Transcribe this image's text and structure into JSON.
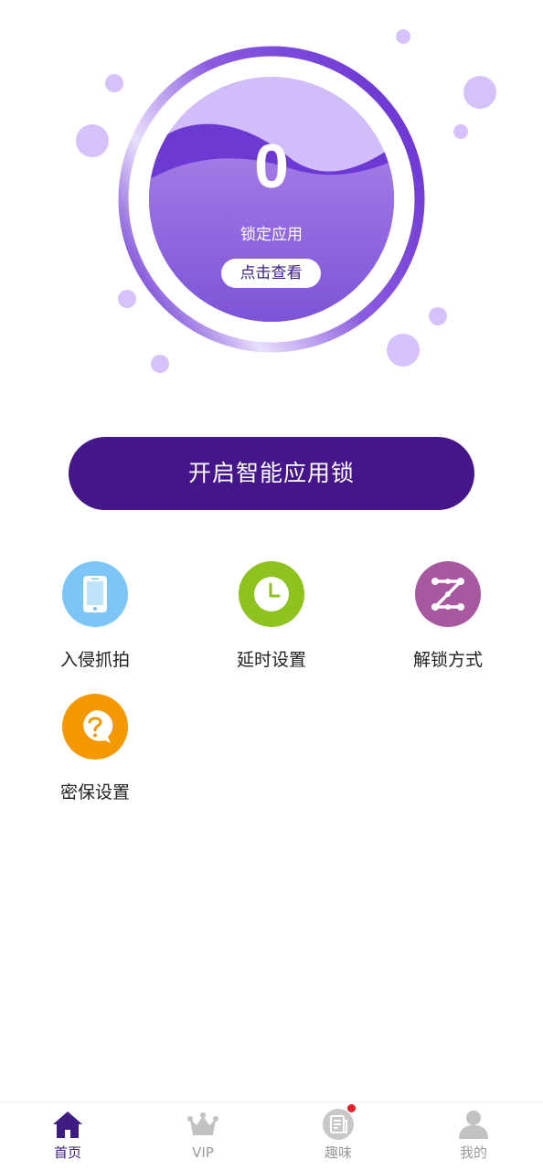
{
  "hero": {
    "locked_count": "0",
    "locked_label": "锁定应用",
    "view_button": "点击查看"
  },
  "main_button": "开启智能应用锁",
  "features": [
    {
      "label": "入侵抓拍",
      "icon": "phone-icon",
      "color": "#7cc6f7"
    },
    {
      "label": "延时设置",
      "icon": "clock-icon",
      "color": "#8dc21f"
    },
    {
      "label": "解锁方式",
      "icon": "pattern-z-icon",
      "color": "#a8589e"
    },
    {
      "label": "密保设置",
      "icon": "question-bubble-icon",
      "color": "#f39800"
    }
  ],
  "nav": {
    "items": [
      {
        "label": "首页",
        "icon": "home-icon",
        "active": true
      },
      {
        "label": "VIP",
        "icon": "crown-icon",
        "active": false
      },
      {
        "label": "趣味",
        "icon": "news-icon",
        "active": false,
        "badge": true
      },
      {
        "label": "我的",
        "icon": "user-icon",
        "active": false
      }
    ]
  },
  "colors": {
    "brand": "#44168a",
    "accent_light": "#d6c2fb",
    "badge": "#e8202a"
  }
}
